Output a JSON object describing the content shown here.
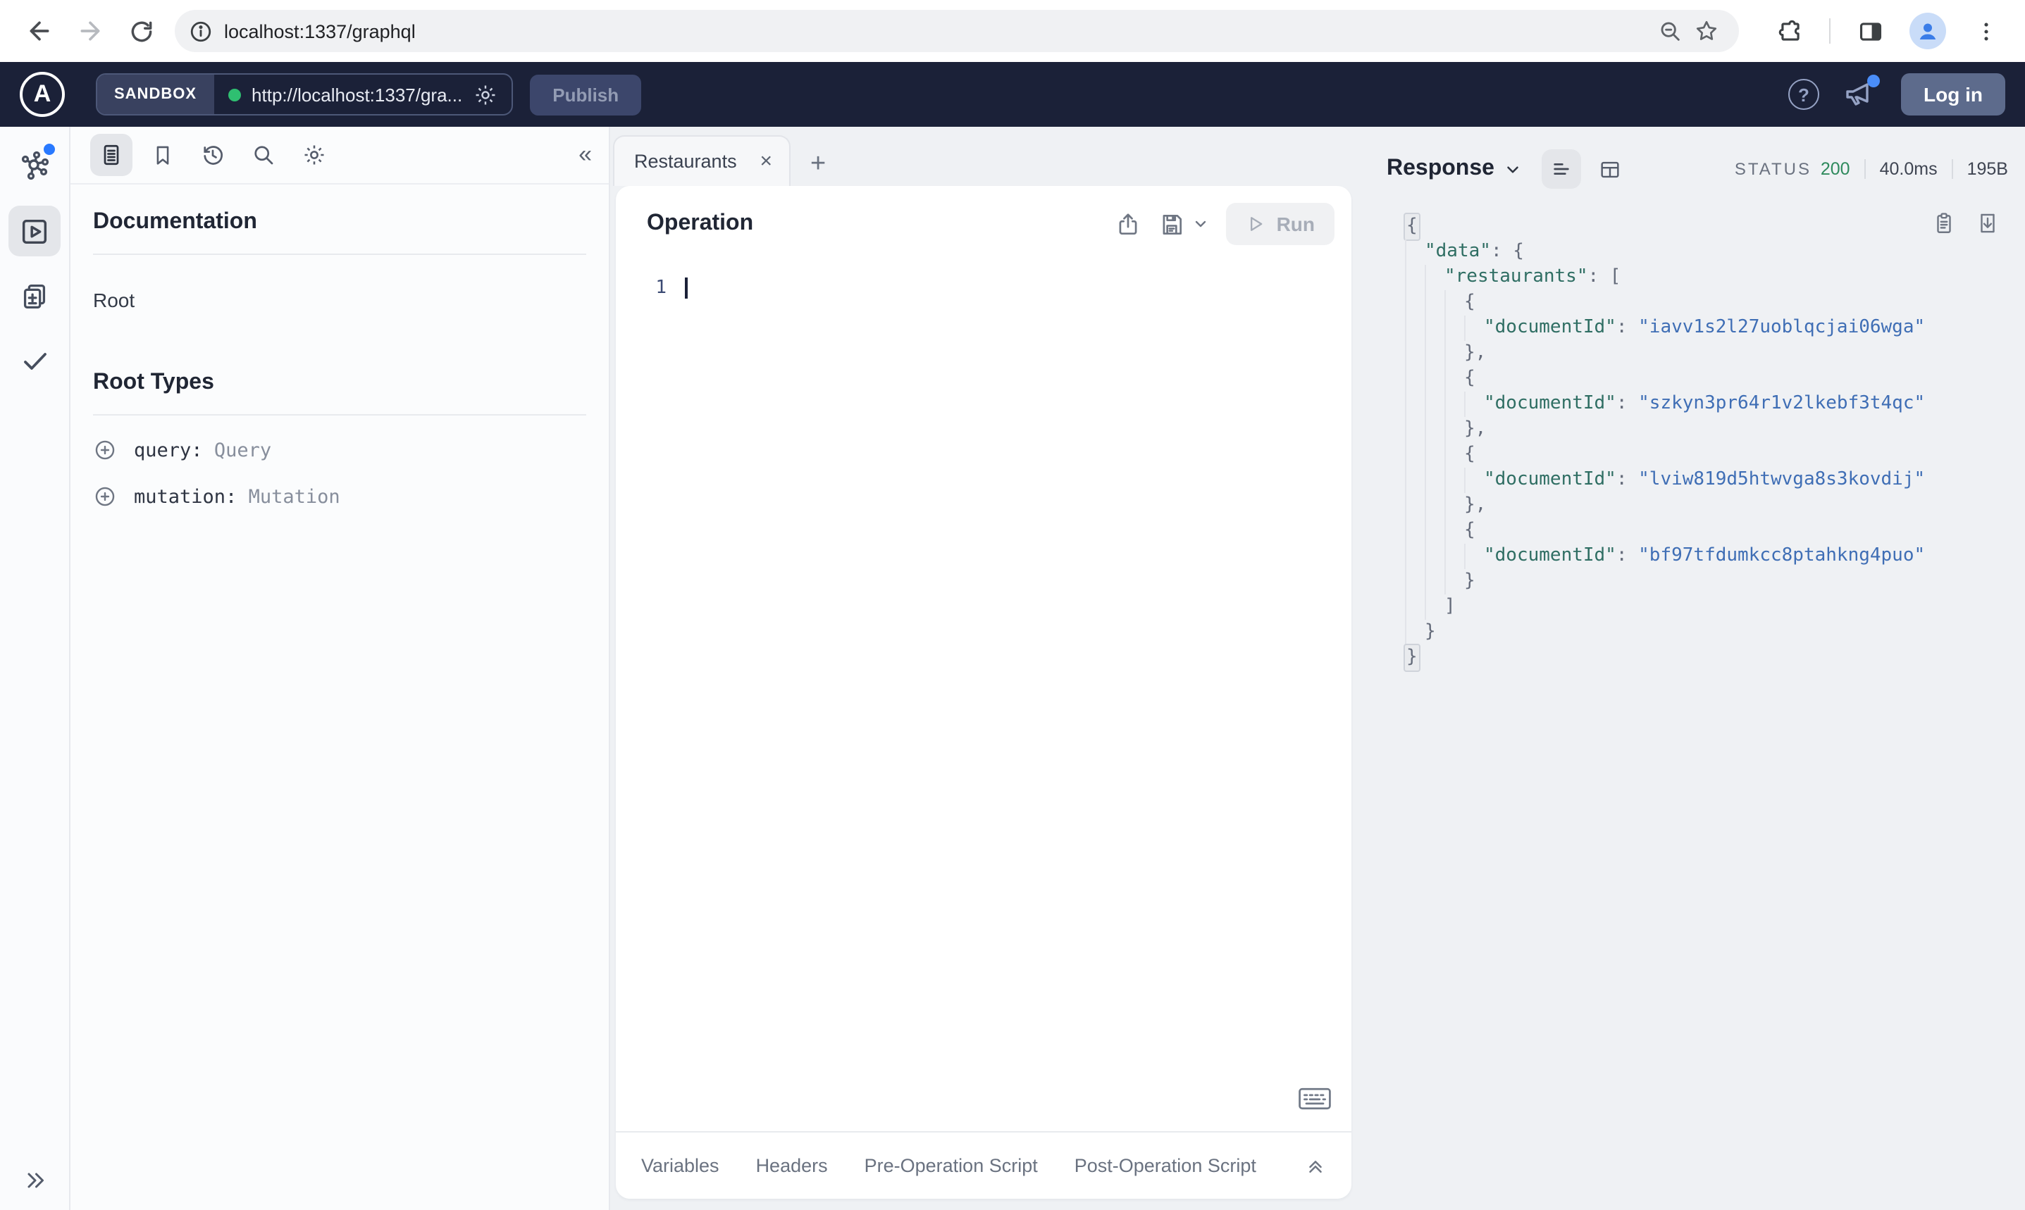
{
  "browser": {
    "url": "localhost:1337/graphql"
  },
  "header": {
    "brand_letter": "A",
    "env_label": "SANDBOX",
    "endpoint_url": "http://localhost:1337/gra...",
    "publish_label": "Publish",
    "login_label": "Log in",
    "help_glyph": "?",
    "colors": {
      "header_bg": "#1b2138",
      "accent_green": "#2fbf71",
      "notification_blue": "#4a8df8"
    }
  },
  "sidebar": {
    "doc_title": "Documentation",
    "root_link": "Root",
    "root_types_title": "Root Types",
    "root_types": [
      {
        "field": "query:",
        "type": "Query"
      },
      {
        "field": "mutation:",
        "type": "Mutation"
      }
    ]
  },
  "tabs": {
    "active_label": "Restaurants",
    "close_glyph": "×",
    "new_tab_glyph": "+"
  },
  "operation": {
    "title": "Operation",
    "run_label": "Run",
    "line_number": "1",
    "footer_tabs": [
      "Variables",
      "Headers",
      "Pre-Operation Script",
      "Post-Operation Script"
    ]
  },
  "response": {
    "title": "Response",
    "status_label": "STATUS",
    "status_code": "200",
    "time": "40.0ms",
    "size": "195B",
    "syntax_colors": {
      "key": "#2f6e63",
      "string": "#3f6eb5",
      "punct": "#646b7a",
      "status_green": "#2f8a5d"
    },
    "lines": [
      {
        "indent": 0,
        "tokens": [
          {
            "type": "punct",
            "text": "{",
            "hl": true
          }
        ]
      },
      {
        "indent": 1,
        "tokens": [
          {
            "type": "key",
            "text": "\"data\""
          },
          {
            "type": "punct",
            "text": ": {"
          }
        ]
      },
      {
        "indent": 2,
        "tokens": [
          {
            "type": "key",
            "text": "\"restaurants\""
          },
          {
            "type": "punct",
            "text": ": ["
          }
        ]
      },
      {
        "indent": 3,
        "tokens": [
          {
            "type": "punct",
            "text": "{"
          }
        ]
      },
      {
        "indent": 4,
        "tokens": [
          {
            "type": "key",
            "text": "\"documentId\""
          },
          {
            "type": "punct",
            "text": ": "
          },
          {
            "type": "str",
            "text": "\"iavv1s2l27uoblqcjai06wga\""
          }
        ]
      },
      {
        "indent": 3,
        "tokens": [
          {
            "type": "punct",
            "text": "},"
          }
        ]
      },
      {
        "indent": 3,
        "tokens": [
          {
            "type": "punct",
            "text": "{"
          }
        ]
      },
      {
        "indent": 4,
        "tokens": [
          {
            "type": "key",
            "text": "\"documentId\""
          },
          {
            "type": "punct",
            "text": ": "
          },
          {
            "type": "str",
            "text": "\"szkyn3pr64r1v2lkebf3t4qc\""
          }
        ]
      },
      {
        "indent": 3,
        "tokens": [
          {
            "type": "punct",
            "text": "},"
          }
        ]
      },
      {
        "indent": 3,
        "tokens": [
          {
            "type": "punct",
            "text": "{"
          }
        ]
      },
      {
        "indent": 4,
        "tokens": [
          {
            "type": "key",
            "text": "\"documentId\""
          },
          {
            "type": "punct",
            "text": ": "
          },
          {
            "type": "str",
            "text": "\"lviw819d5htwvga8s3kovdij\""
          }
        ]
      },
      {
        "indent": 3,
        "tokens": [
          {
            "type": "punct",
            "text": "},"
          }
        ]
      },
      {
        "indent": 3,
        "tokens": [
          {
            "type": "punct",
            "text": "{"
          }
        ]
      },
      {
        "indent": 4,
        "tokens": [
          {
            "type": "key",
            "text": "\"documentId\""
          },
          {
            "type": "punct",
            "text": ": "
          },
          {
            "type": "str",
            "text": "\"bf97tfdumkcc8ptahkng4puo\""
          }
        ]
      },
      {
        "indent": 3,
        "tokens": [
          {
            "type": "punct",
            "text": "}"
          }
        ]
      },
      {
        "indent": 2,
        "tokens": [
          {
            "type": "punct",
            "text": "]"
          }
        ]
      },
      {
        "indent": 1,
        "tokens": [
          {
            "type": "punct",
            "text": "}"
          }
        ]
      },
      {
        "indent": 0,
        "tokens": [
          {
            "type": "punct",
            "text": "}",
            "hl": true
          }
        ]
      }
    ]
  }
}
